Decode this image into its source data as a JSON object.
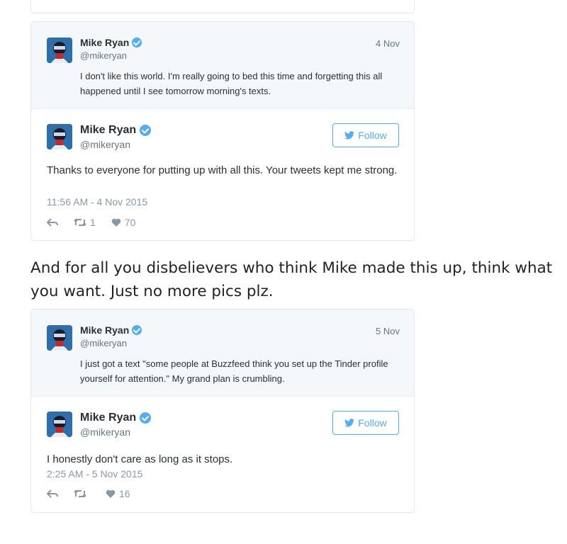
{
  "embed1": {
    "quoted": {
      "name": "Mike Ryan",
      "handle": "@mikeryan",
      "date": "4 Nov",
      "text": "I don't like this world. I'm really going to bed this time and forgetting this all happened until I see tomorrow morning's texts."
    },
    "main": {
      "name": "Mike Ryan",
      "handle": "@mikeryan",
      "follow_label": "Follow",
      "text": "Thanks to everyone for putting up with all this. Your tweets kept me strong.",
      "timestamp": "11:56 AM - 4 Nov 2015",
      "retweets": "1",
      "likes": "70"
    }
  },
  "heading": "And for all you disbelievers who think Mike made this up, think what you want. Just no more pics plz.",
  "embed2": {
    "quoted": {
      "name": "Mike Ryan",
      "handle": "@mikeryan",
      "date": "5 Nov",
      "text": "I just got a text \"some people at Buzzfeed think you set up the Tinder profile yourself for attention.\" My grand plan is crumbling."
    },
    "main": {
      "name": "Mike Ryan",
      "handle": "@mikeryan",
      "follow_label": "Follow",
      "text": "I honestly don't care as long as it stops.",
      "timestamp": "2:25 AM - 5 Nov 2015",
      "retweets": "",
      "likes": "16"
    }
  },
  "icons": {
    "verified": "verified-badge-icon",
    "bird": "twitter-bird-icon",
    "reply": "reply-icon",
    "retweet": "retweet-icon",
    "like": "heart-icon"
  },
  "colors": {
    "accent": "#55acee",
    "quoted_bg": "#f5f8fa",
    "muted": "#8899a6"
  }
}
